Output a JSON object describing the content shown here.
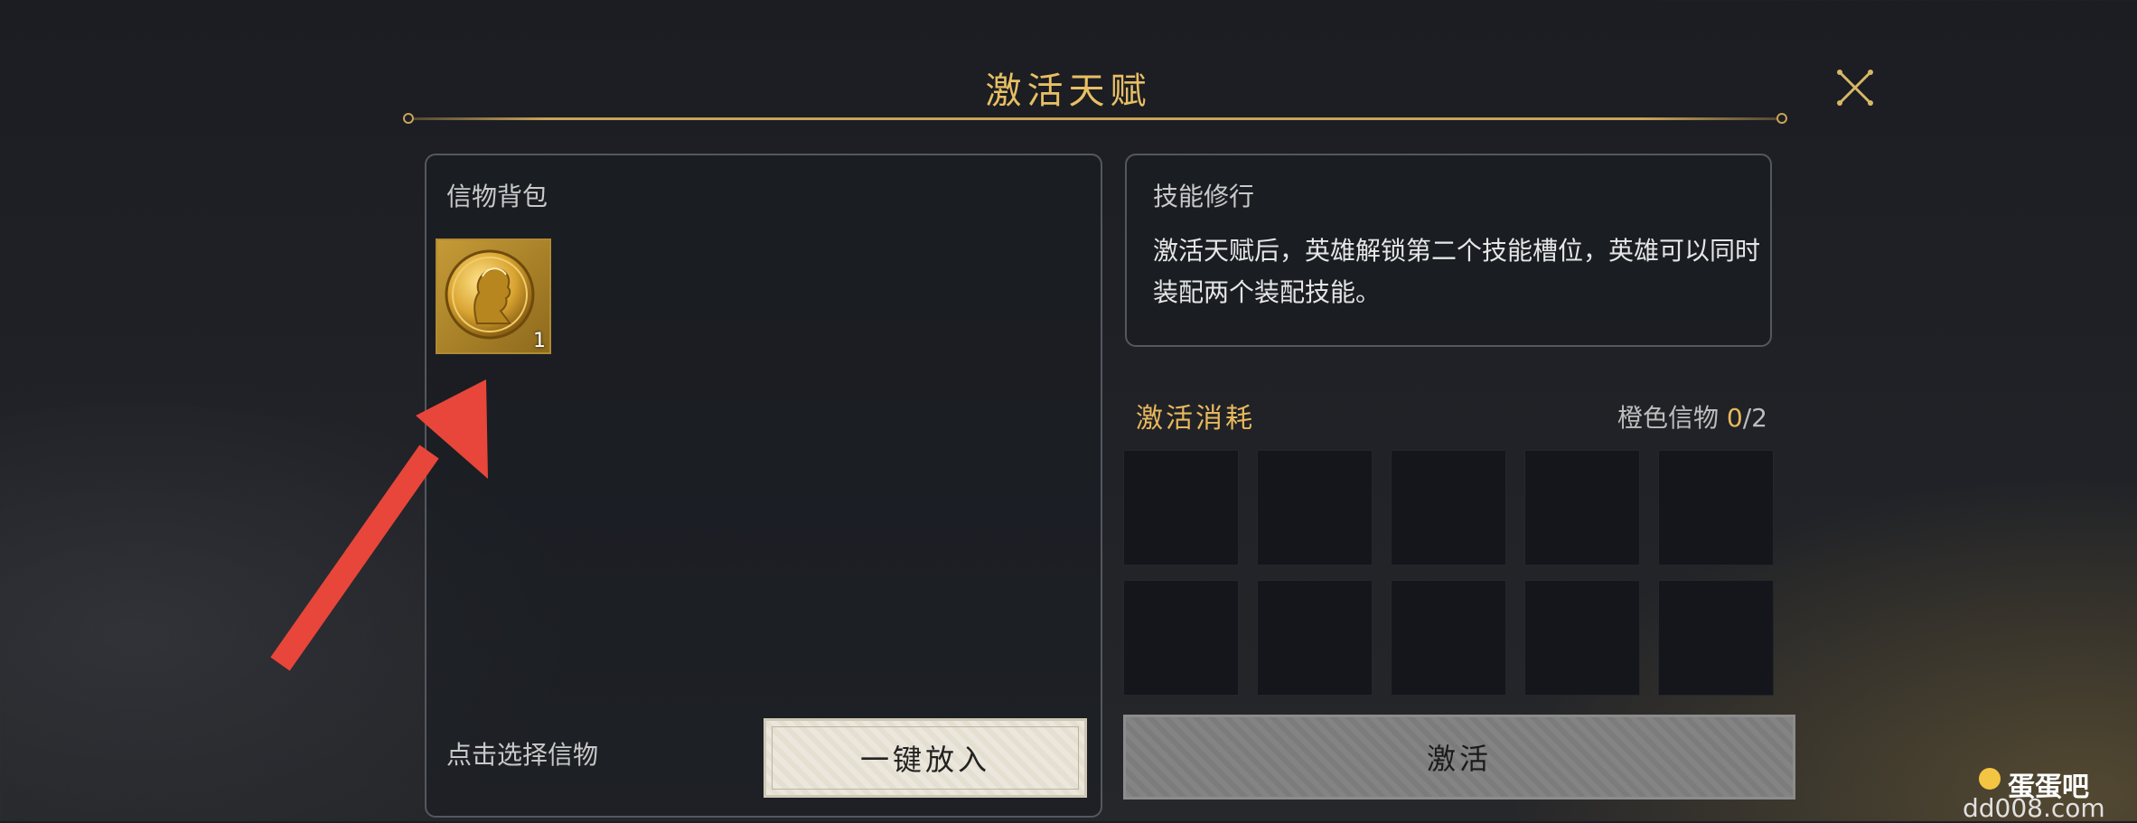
{
  "header": {
    "title": "激活天赋",
    "close_icon": "close-x-icon"
  },
  "inventory": {
    "title": "信物背包",
    "items": [
      {
        "icon": "gold-coin-portrait-icon",
        "count": "1"
      }
    ],
    "hint": "点击选择信物",
    "auto_button_label": "一键放入"
  },
  "skill": {
    "title": "技能修行",
    "description": "激活天赋后，英雄解锁第二个技能槽位，英雄可以同时装配两个装配技能。"
  },
  "cost": {
    "title": "激活消耗",
    "requirement_label": "橙色信物",
    "current": "0",
    "required": "/2",
    "slot_count": 10
  },
  "activate_button_label": "激活",
  "watermark": {
    "brand": "蛋蛋吧",
    "url": "dd008.com"
  },
  "colors": {
    "accent_gold": "#e8b85d",
    "annotation_arrow": "#e8463a"
  }
}
